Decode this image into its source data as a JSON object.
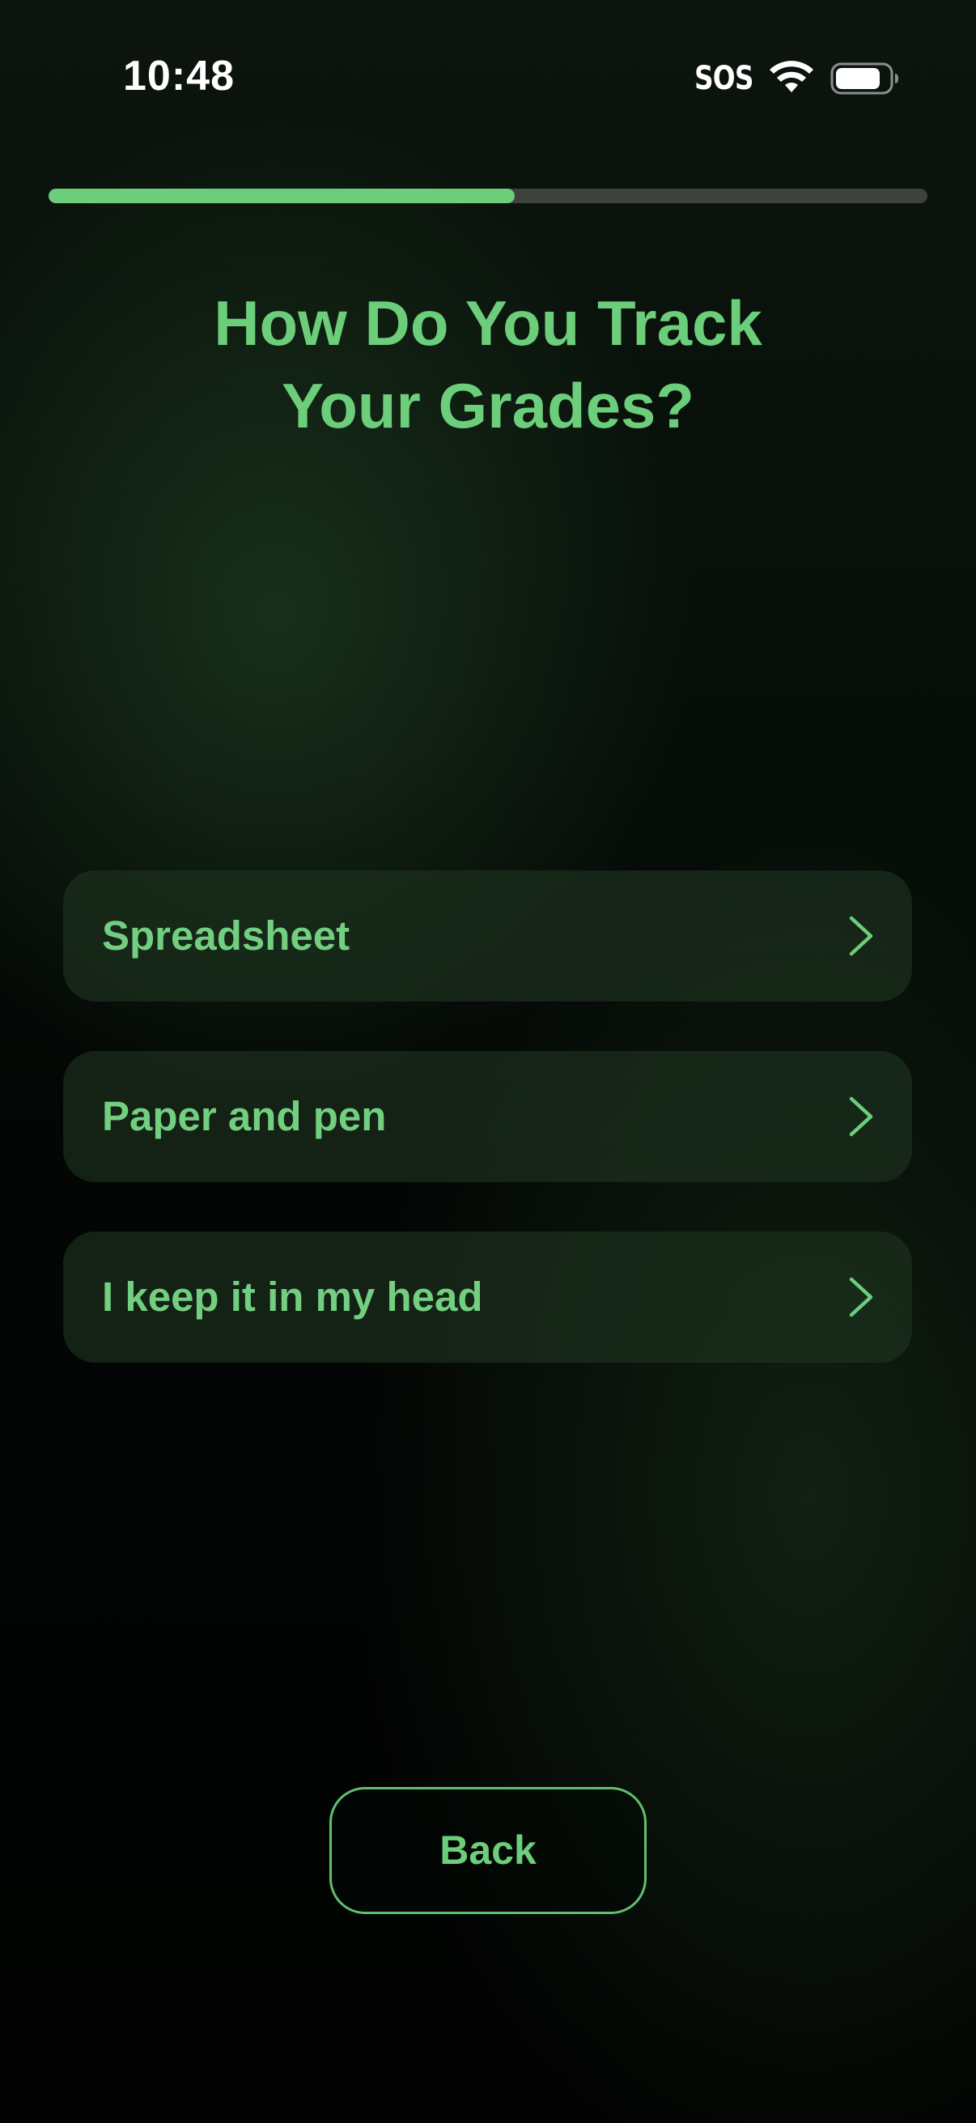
{
  "status_bar": {
    "time": "10:48",
    "sos": "SOS",
    "wifi_icon": "wifi-icon",
    "battery_icon": "battery-icon"
  },
  "progress": {
    "fraction": 0.53,
    "fill_color": "#6ccd7a",
    "track_color": "#3e423f"
  },
  "title": {
    "line1": "How Do You Track",
    "line2": "Your Grades?"
  },
  "options": [
    {
      "label": "Spreadsheet",
      "icon": "chevron-right-icon"
    },
    {
      "label": "Paper and pen",
      "icon": "chevron-right-icon"
    },
    {
      "label": "I keep it in my head",
      "icon": "chevron-right-icon"
    }
  ],
  "back_button": {
    "label": "Back"
  },
  "colors": {
    "accent": "#6ccd7a",
    "background": "#030503",
    "option_background": "#1e3421"
  }
}
